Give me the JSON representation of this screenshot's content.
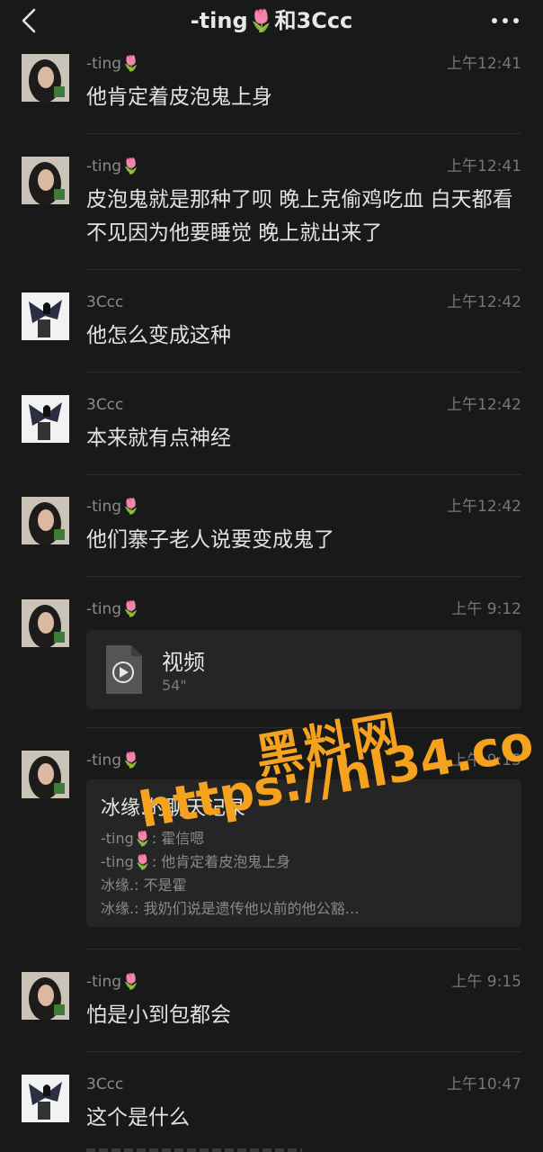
{
  "header": {
    "title": "-ting🌷和3Ccc"
  },
  "icons": {
    "back": "chevron-left-icon",
    "more": "more-dots-icon",
    "video": "video-file-icon"
  },
  "watermark": {
    "line1": "黑料网",
    "line2": "https://hl34.co"
  },
  "messages": [
    {
      "sender": "-ting🌷",
      "time": "上午12:41",
      "text": "他肯定着皮泡鬼上身"
    },
    {
      "sender": "-ting🌷",
      "time": "上午12:41",
      "text": "皮泡鬼就是那种了呗 晚上克偷鸡吃血 白天都看不见因为他要睡觉 晚上就出来了"
    },
    {
      "sender": "3Ccc",
      "time": "上午12:42",
      "text": "他怎么变成这种"
    },
    {
      "sender": "3Ccc",
      "time": "上午12:42",
      "text": "本来就有点神经"
    },
    {
      "sender": "-ting🌷",
      "time": "上午12:42",
      "text": "他们寨子老人说要变成鬼了"
    },
    {
      "sender": "-ting🌷",
      "time": "上午 9:12",
      "video": {
        "title": "视频",
        "duration": "54\""
      }
    },
    {
      "sender": "-ting🌷",
      "time": "上午 9:15",
      "record": {
        "title": "冰缘.的聊天记录",
        "lines": [
          "-ting🌷: 霍信嗯",
          "-ting🌷: 他肯定着皮泡鬼上身",
          "冰缘.: 不是霍",
          "冰缘.: 我奶们说是遗传他以前的他公豁…"
        ]
      }
    },
    {
      "sender": "-ting🌷",
      "time": "上午 9:15",
      "text": "怕是小到包都会"
    },
    {
      "sender": "3Ccc",
      "time": "上午10:47",
      "text": "这个是什么"
    }
  ]
}
